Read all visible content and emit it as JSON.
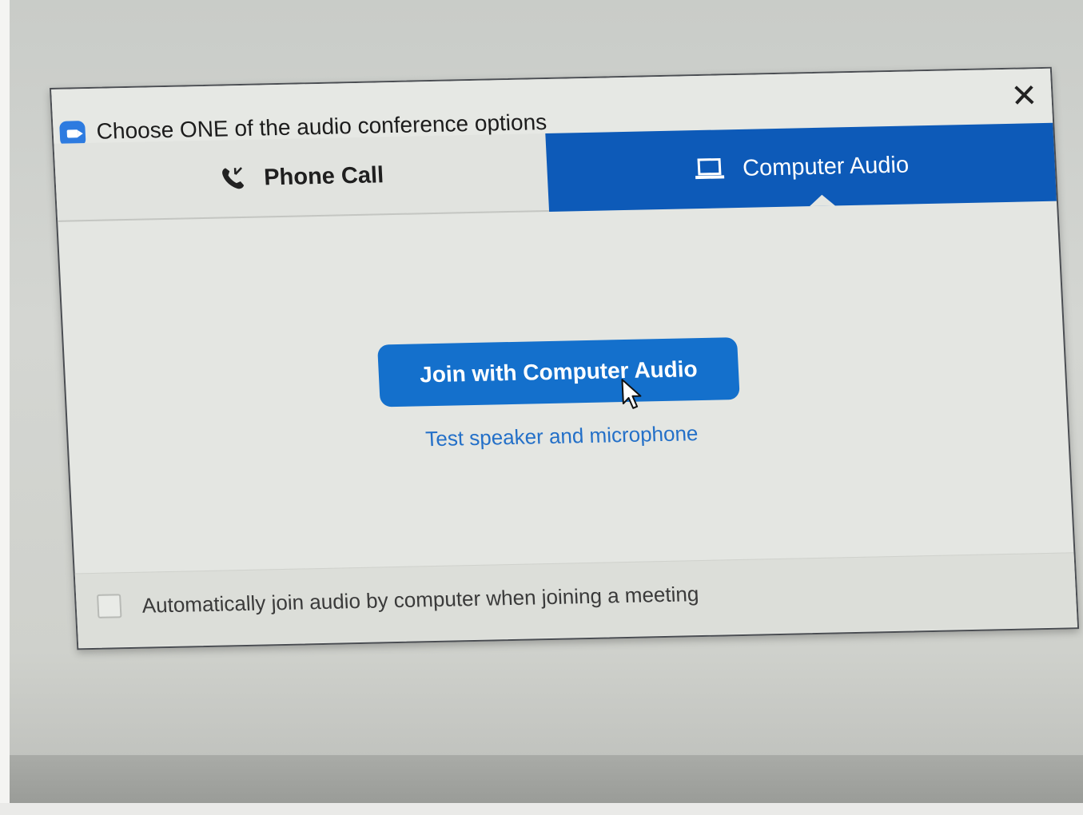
{
  "dialog": {
    "title": "Choose ONE of the audio conference options",
    "app_icon": "video-camera-icon",
    "close_icon": "close-icon",
    "close_glyph": "✕"
  },
  "tabs": [
    {
      "label": "Phone Call",
      "icon": "phone-icon",
      "selected": false
    },
    {
      "label": "Computer Audio",
      "icon": "laptop-icon",
      "selected": true
    }
  ],
  "main": {
    "join_button_label": "Join with Computer Audio",
    "test_link_label": "Test speaker and microphone"
  },
  "footer": {
    "auto_join_label": "Automatically join audio by computer when joining a meeting",
    "auto_join_checked": false
  },
  "colors": {
    "accent": "#0d5ab8",
    "button": "#1470cc",
    "link": "#2470c8"
  }
}
